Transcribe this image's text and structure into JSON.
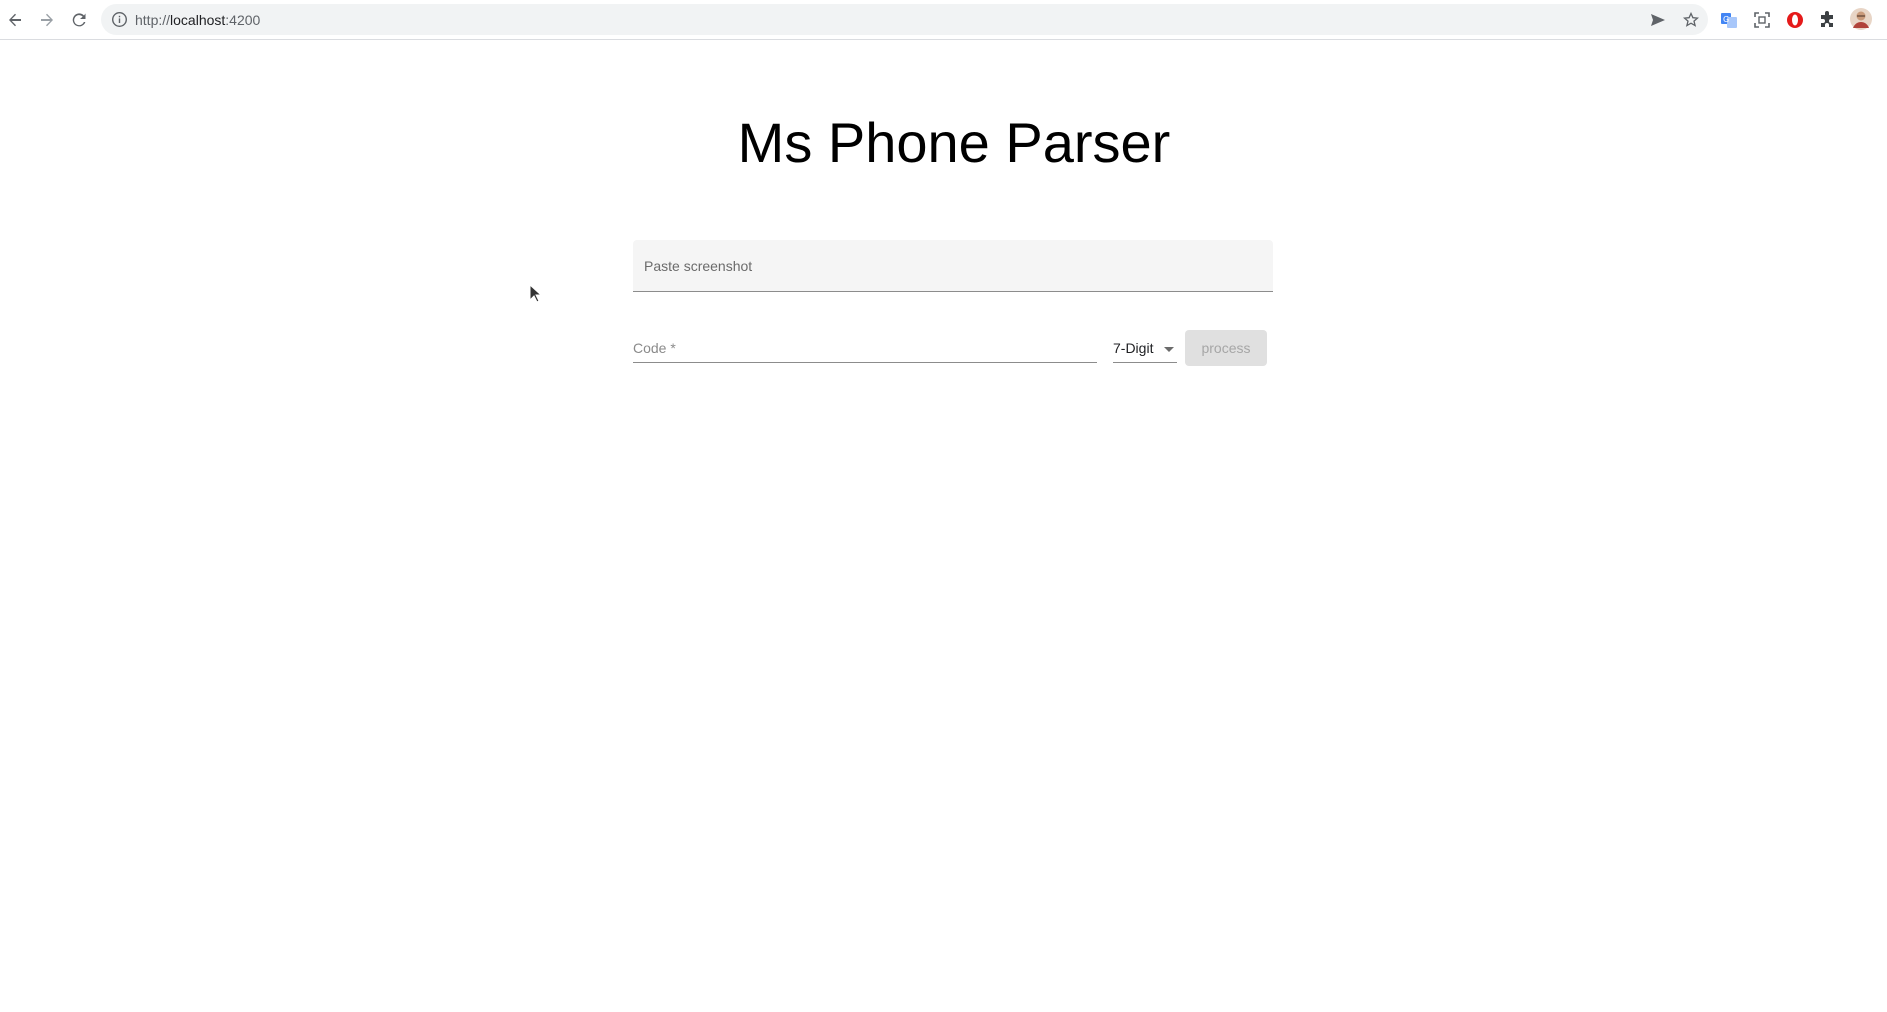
{
  "browser": {
    "url_scheme": "http://",
    "url_host": "localhost",
    "url_port": ":4200",
    "icons": [
      "back-arrow-icon",
      "forward-arrow-icon",
      "reload-icon",
      "info-icon",
      "send-icon",
      "star-icon",
      "translate-icon",
      "screenshot-icon",
      "opera-icon",
      "puzzle-icon",
      "profile-avatar"
    ]
  },
  "page": {
    "title": "Ms Phone Parser",
    "paste_label": "Paste screenshot",
    "code_label": "Code *",
    "digit_select_value": "7-Digit",
    "process_label": "process"
  },
  "colors": {
    "field_bg": "#f5f5f5",
    "button_disabled_bg": "#e0e0e0",
    "button_disabled_text": "#a6a6a6"
  }
}
